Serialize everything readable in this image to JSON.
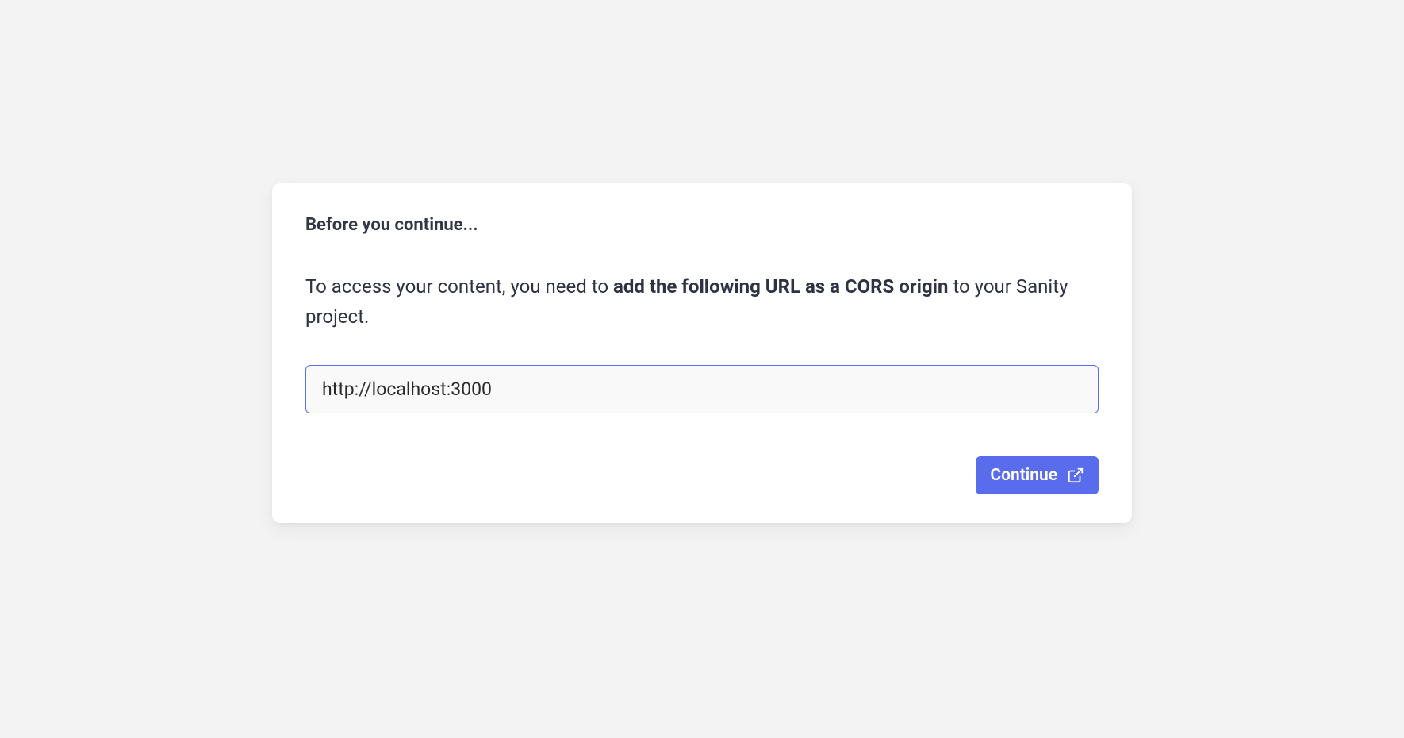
{
  "dialog": {
    "title": "Before you continue...",
    "description_prefix": "To access your content, you need to ",
    "description_bold": "add the following URL as a CORS origin",
    "description_suffix": " to your Sanity project.",
    "url_value": "http://localhost:3000",
    "continue_label": "Continue"
  }
}
